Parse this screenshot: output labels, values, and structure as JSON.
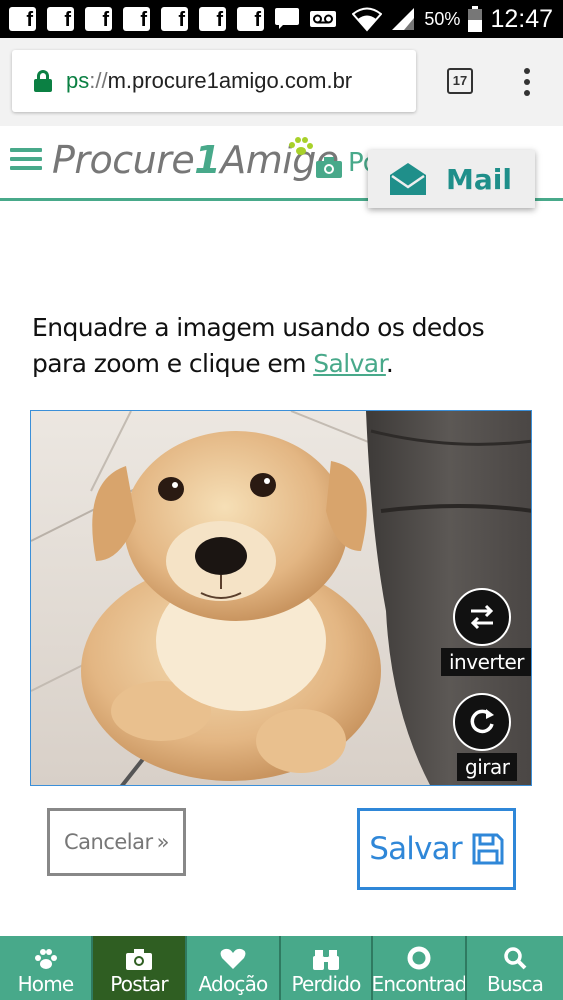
{
  "status_bar": {
    "notification_icons": [
      "facebook-icon",
      "facebook-icon",
      "facebook-icon",
      "facebook-icon",
      "facebook-icon",
      "facebook-icon",
      "facebook-icon",
      "chat-icon",
      "voicemail-icon"
    ],
    "battery": "50%",
    "time": "12:47"
  },
  "browser": {
    "url_scheme": "ps",
    "url_sep": "://",
    "url_host": "m.procure1amigo.com.br",
    "tab_count": "17"
  },
  "header": {
    "logo_part1": "Procure",
    "logo_one": "1",
    "logo_part2": "Amigo",
    "truncated_menu": "Po",
    "mail_label": "Mail"
  },
  "instructions": {
    "text_before": "Enquadre a imagem usando os dedos para zoom e clique em ",
    "link": "Salvar",
    "text_after": "."
  },
  "image_controls": {
    "invert_label": "inverter",
    "rotate_label": "girar"
  },
  "actions": {
    "cancel_label": "Cancelar",
    "cancel_suffix": "»",
    "save_label": "Salvar"
  },
  "bottom_nav": [
    {
      "label": "Home",
      "icon": "paw-icon",
      "active": false
    },
    {
      "label": "Postar",
      "icon": "camera-icon",
      "active": true
    },
    {
      "label": "Adoção",
      "icon": "heart-icon",
      "active": false
    },
    {
      "label": "Perdido",
      "icon": "binoculars-icon",
      "active": false
    },
    {
      "label": "Encontrad",
      "icon": "lifebuoy-icon",
      "active": false
    },
    {
      "label": "Busca",
      "icon": "search-icon",
      "active": false
    }
  ],
  "colors": {
    "brand_green": "#48a98a",
    "save_blue": "#2f87d8",
    "mail_teal": "#1f8f8a",
    "active_nav": "#2f5e22"
  }
}
